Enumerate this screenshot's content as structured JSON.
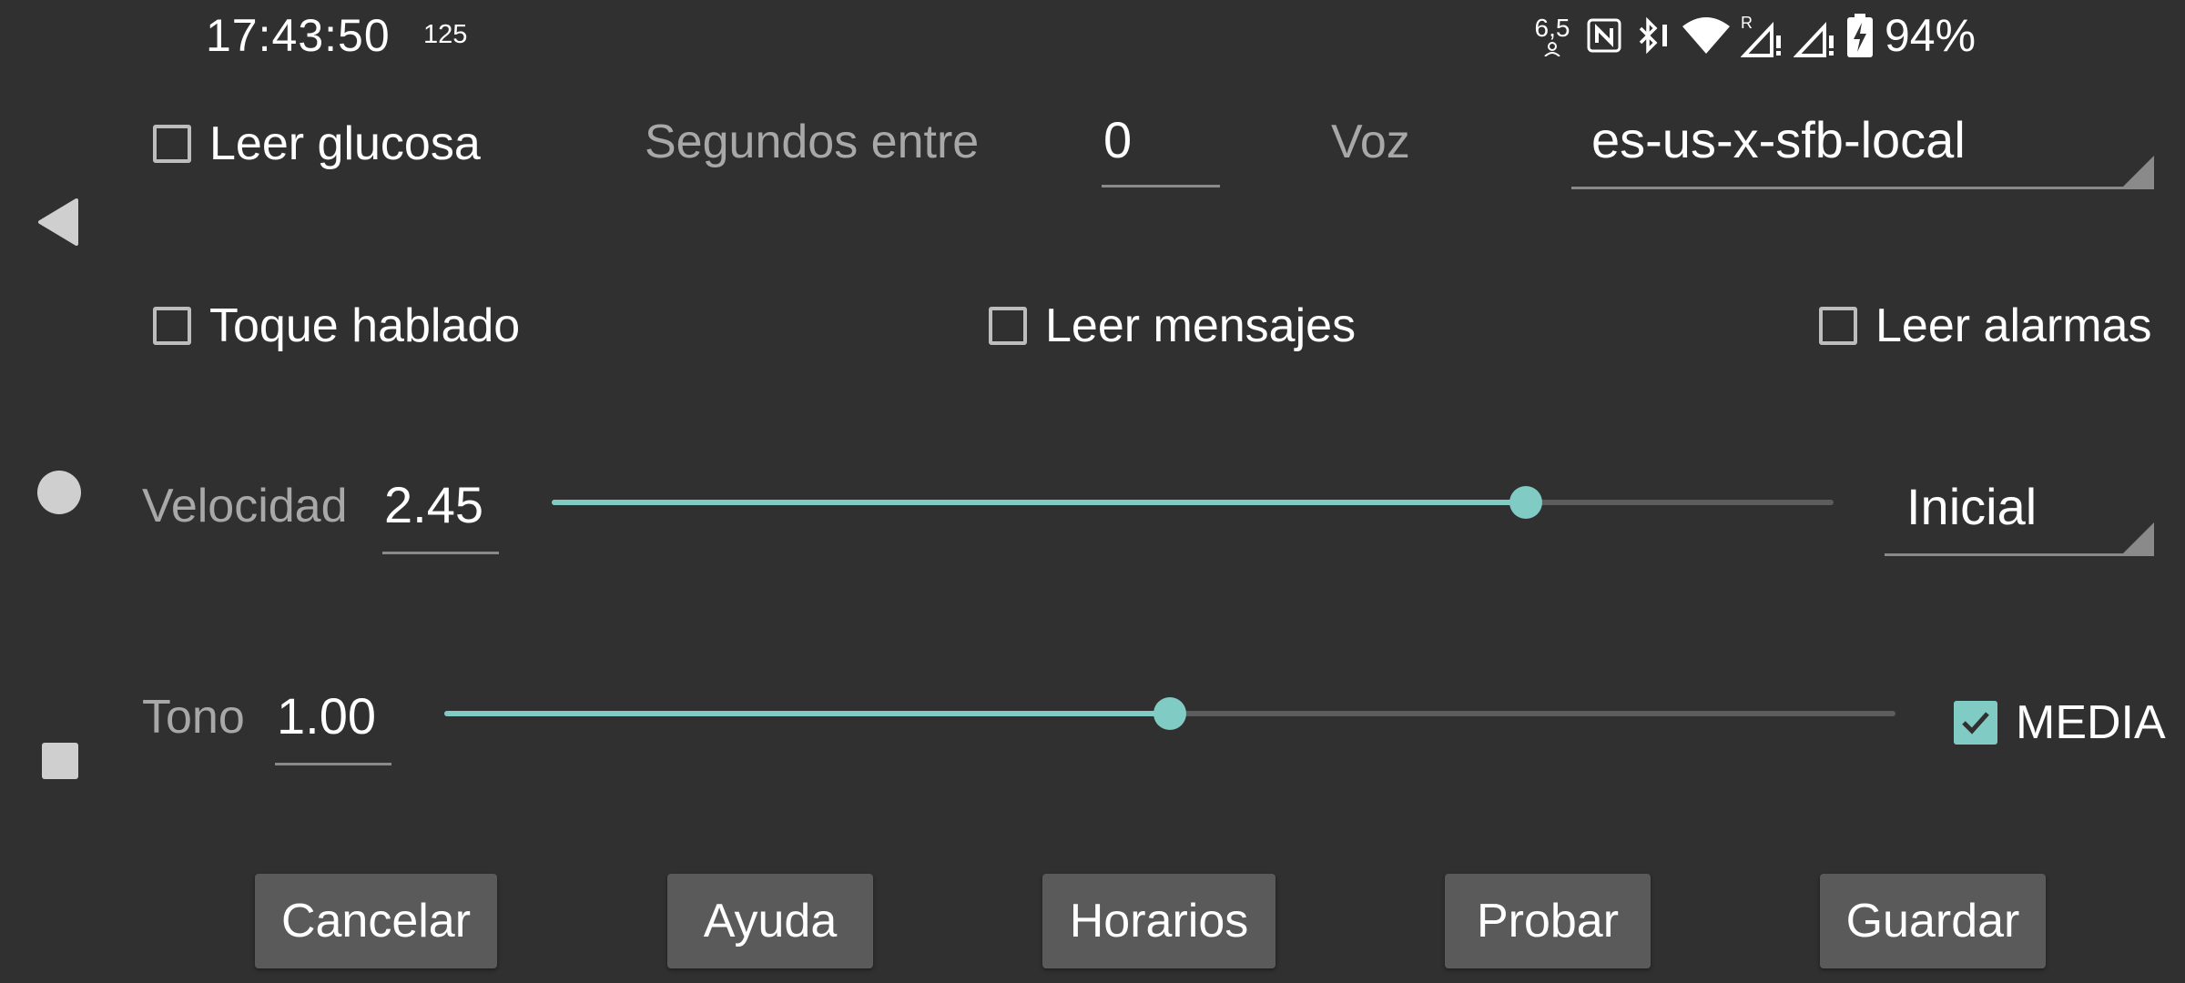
{
  "status_bar": {
    "time": "17:43:50",
    "time_sub": "125",
    "dnd_value": "6,5",
    "battery_percent": "94%",
    "icons": [
      "nfc-icon",
      "bluetooth-icon",
      "wifi-icon",
      "signal-roaming-icon",
      "signal-icon",
      "battery-charging-icon"
    ]
  },
  "nav": {
    "icons": [
      "back-icon",
      "home-icon",
      "recents-icon"
    ]
  },
  "row1": {
    "read_glucose_label": "Leer glucosa",
    "read_glucose_checked": false,
    "seconds_label": "Segundos entre",
    "seconds_value": "0",
    "voice_label": "Voz",
    "voice_value": "es-us-x-sfb-local"
  },
  "row2": {
    "spoken_touch_label": "Toque hablado",
    "spoken_touch_checked": false,
    "read_messages_label": "Leer mensajes",
    "read_messages_checked": false,
    "read_alarms_label": "Leer alarmas",
    "read_alarms_checked": false
  },
  "speed": {
    "label": "Velocidad",
    "value": "2.45",
    "slider_fraction": 0.76,
    "preset": "Inicial"
  },
  "pitch": {
    "label": "Tono",
    "value": "1.00",
    "slider_fraction": 0.5,
    "media_label": "MEDIA",
    "media_checked": true
  },
  "buttons": {
    "cancel": "Cancelar",
    "help": "Ayuda",
    "schedules": "Horarios",
    "test": "Probar",
    "save": "Guardar"
  },
  "colors": {
    "background": "#303030",
    "accent": "#80cbc4",
    "button": "#5a5a5a"
  }
}
